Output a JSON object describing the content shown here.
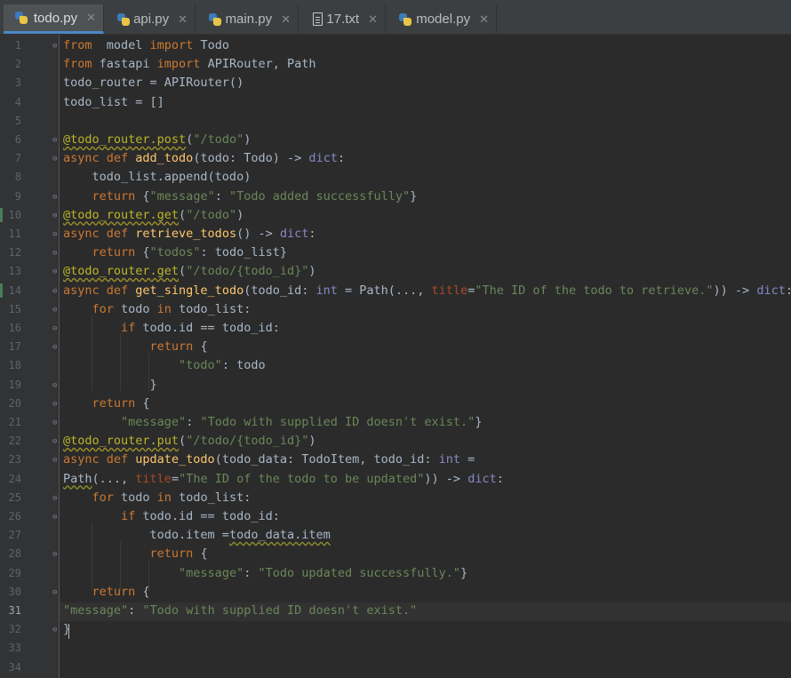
{
  "tabs": [
    {
      "label": "todo.py",
      "icon": "python-file-icon",
      "active": true
    },
    {
      "label": "api.py",
      "icon": "python-file-icon",
      "active": false
    },
    {
      "label": "main.py",
      "icon": "python-file-icon",
      "active": false
    },
    {
      "label": "17.txt",
      "icon": "text-file-icon",
      "active": false
    },
    {
      "label": "model.py",
      "icon": "python-file-icon",
      "active": false
    }
  ],
  "tab_close_glyph": "✕",
  "fold_glyph": "⊖",
  "current_line": 31,
  "lines": [
    {
      "n": "1",
      "tokens": [
        [
          "kw",
          "from"
        ],
        [
          "",
          "  model "
        ],
        [
          "kw",
          "import"
        ],
        [
          "",
          " Todo"
        ]
      ]
    },
    {
      "n": "2",
      "tokens": [
        [
          "kw",
          "from"
        ],
        [
          "",
          " fastapi "
        ],
        [
          "kw",
          "import"
        ],
        [
          "",
          " APIRouter, Path"
        ]
      ]
    },
    {
      "n": "3",
      "tokens": [
        [
          "",
          "todo_router = APIRouter()"
        ]
      ]
    },
    {
      "n": "4",
      "tokens": [
        [
          "",
          "todo_list = []"
        ]
      ]
    },
    {
      "n": "5",
      "tokens": []
    },
    {
      "n": "6",
      "tokens": [
        [
          "dec",
          "@todo_router.post"
        ],
        [
          "",
          "("
        ],
        [
          "str",
          "\"/todo\""
        ],
        [
          "",
          ")"
        ]
      ]
    },
    {
      "n": "7",
      "tokens": [
        [
          "kw",
          "async def "
        ],
        [
          "fn",
          "add_todo"
        ],
        [
          "",
          "(todo: Todo) -> "
        ],
        [
          "bi",
          "dict"
        ],
        [
          "",
          ":"
        ]
      ]
    },
    {
      "n": "8",
      "tokens": [
        [
          "",
          "    todo_list.append(todo)"
        ]
      ]
    },
    {
      "n": "9",
      "tokens": [
        [
          "kw",
          "    return "
        ],
        [
          "",
          "{"
        ],
        [
          "str",
          "\"message\""
        ],
        [
          "",
          ": "
        ],
        [
          "str",
          "\"Todo added successfully\""
        ],
        [
          "",
          "}"
        ]
      ]
    },
    {
      "n": "10",
      "tokens": [
        [
          "dec",
          "@todo_router.get"
        ],
        [
          "",
          "("
        ],
        [
          "str",
          "\"/todo\""
        ],
        [
          "",
          ")"
        ]
      ]
    },
    {
      "n": "11",
      "tokens": [
        [
          "kw",
          "async def "
        ],
        [
          "fn",
          "retrieve_todos"
        ],
        [
          "",
          "() -> "
        ],
        [
          "bi",
          "dict"
        ],
        [
          "",
          ":"
        ]
      ]
    },
    {
      "n": "12",
      "tokens": [
        [
          "kw",
          "    return "
        ],
        [
          "",
          "{"
        ],
        [
          "str",
          "\"todos\""
        ],
        [
          "",
          ": todo_list}"
        ]
      ]
    },
    {
      "n": "13",
      "tokens": [
        [
          "dec",
          "@todo_router.get"
        ],
        [
          "",
          "("
        ],
        [
          "str",
          "\"/todo/{todo_id}\""
        ],
        [
          "",
          ")"
        ]
      ]
    },
    {
      "n": "14",
      "tokens": [
        [
          "kw",
          "async def "
        ],
        [
          "fn",
          "get_single_todo"
        ],
        [
          "",
          "(todo_id: "
        ],
        [
          "bi",
          "int"
        ],
        [
          "",
          " = Path(..., "
        ],
        [
          "param",
          "title"
        ],
        [
          "",
          "="
        ],
        [
          "str",
          "\"The ID of the todo to retrieve.\""
        ],
        [
          "",
          ")) -> "
        ],
        [
          "bi",
          "dict"
        ],
        [
          "",
          ":"
        ]
      ]
    },
    {
      "n": "15",
      "tokens": [
        [
          "kw",
          "    for "
        ],
        [
          "",
          "todo "
        ],
        [
          "kw",
          "in "
        ],
        [
          "",
          "todo_list:"
        ]
      ]
    },
    {
      "n": "16",
      "tokens": [
        [
          "kw",
          "        if "
        ],
        [
          "",
          "todo.id == todo_id:"
        ]
      ]
    },
    {
      "n": "17",
      "tokens": [
        [
          "kw",
          "            return "
        ],
        [
          "",
          "{"
        ]
      ]
    },
    {
      "n": "18",
      "tokens": [
        [
          "",
          "                "
        ],
        [
          "str",
          "\"todo\""
        ],
        [
          "",
          ": todo"
        ]
      ]
    },
    {
      "n": "19",
      "tokens": [
        [
          "",
          "            }"
        ]
      ]
    },
    {
      "n": "20",
      "tokens": [
        [
          "kw",
          "    return "
        ],
        [
          "",
          "{"
        ]
      ]
    },
    {
      "n": "21",
      "tokens": [
        [
          "",
          "        "
        ],
        [
          "str",
          "\"message\""
        ],
        [
          "",
          ": "
        ],
        [
          "str",
          "\"Todo with supplied ID doesn't exist.\""
        ],
        [
          "",
          "}"
        ]
      ]
    },
    {
      "n": "22",
      "tokens": [
        [
          "dec",
          "@todo_router.put"
        ],
        [
          "",
          "("
        ],
        [
          "str",
          "\"/todo/{todo_id}\""
        ],
        [
          "",
          ")"
        ]
      ]
    },
    {
      "n": "23",
      "tokens": [
        [
          "kw",
          "async def "
        ],
        [
          "fn",
          "update_todo"
        ],
        [
          "",
          "(todo_data: TodoItem, todo_id: "
        ],
        [
          "bi",
          "int"
        ],
        [
          "",
          " ="
        ]
      ]
    },
    {
      "n": "24",
      "tokens": [
        [
          "squig",
          "Path"
        ],
        [
          "",
          "(..., "
        ],
        [
          "param",
          "title"
        ],
        [
          "",
          "="
        ],
        [
          "str",
          "\"The ID of the todo to be updated\""
        ],
        [
          "",
          ")) -> "
        ],
        [
          "bi",
          "dict"
        ],
        [
          "",
          ":"
        ]
      ]
    },
    {
      "n": "25",
      "tokens": [
        [
          "kw",
          "    for "
        ],
        [
          "",
          "todo "
        ],
        [
          "kw",
          "in "
        ],
        [
          "",
          "todo_list:"
        ]
      ]
    },
    {
      "n": "26",
      "tokens": [
        [
          "kw",
          "        if "
        ],
        [
          "",
          "todo.id == todo_id:"
        ]
      ]
    },
    {
      "n": "27",
      "tokens": [
        [
          "",
          "            todo.item ="
        ],
        [
          "squig",
          "todo_data.item"
        ]
      ]
    },
    {
      "n": "28",
      "tokens": [
        [
          "kw",
          "            return "
        ],
        [
          "",
          "{"
        ]
      ]
    },
    {
      "n": "29",
      "tokens": [
        [
          "",
          "                "
        ],
        [
          "str",
          "\"message\""
        ],
        [
          "",
          ": "
        ],
        [
          "str",
          "\"Todo updated successfully.\""
        ],
        [
          "",
          "}"
        ]
      ]
    },
    {
      "n": "30",
      "tokens": [
        [
          "kw",
          "    return "
        ],
        [
          "",
          "{"
        ]
      ]
    },
    {
      "n": "31",
      "tokens": [
        [
          "str",
          "\"message\""
        ],
        [
          "",
          ": "
        ],
        [
          "str",
          "\"Todo with supplied ID doesn't exist.\""
        ]
      ]
    },
    {
      "n": "32",
      "tokens": [
        [
          "",
          "}"
        ]
      ]
    },
    {
      "n": "33",
      "tokens": []
    },
    {
      "n": "34",
      "tokens": []
    }
  ]
}
